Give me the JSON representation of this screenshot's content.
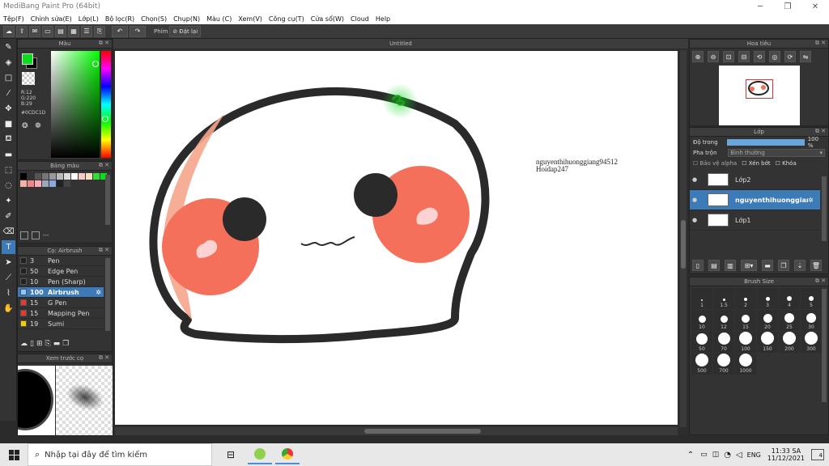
{
  "window": {
    "title": "MediBang Paint Pro (64bit)"
  },
  "menu": [
    "Tệp(F)",
    "Chỉnh sửa(E)",
    "Lớp(L)",
    "Bộ lọc(R)",
    "Chọn(S)",
    "Chụp(N)",
    "Màu (C)",
    "Xem(V)",
    "Công cụ(T)",
    "Cửa sổ(W)",
    "Cloud",
    "Help"
  ],
  "toolbar": {
    "shortcut_label": "Phím",
    "reset_label": "Đặt lại"
  },
  "canvas": {
    "title": "Untitled",
    "watermark_line1": "nguyenthihuonggiang94512",
    "watermark_line2": "Hoidap247"
  },
  "color_panel": {
    "title": "Màu",
    "r": "R:12",
    "g": "G:220",
    "b": "B:29",
    "hex": "#0CDC1D",
    "fg_color": "#0CDC1D",
    "bg_color": "#000000"
  },
  "palette_panel": {
    "title": "Bảng màu",
    "footer": "---"
  },
  "brush_panel": {
    "title": "Cọ: Airbrush",
    "brushes": [
      {
        "size": "3",
        "name": "Pen",
        "color": "#222222"
      },
      {
        "size": "50",
        "name": "Edge Pen",
        "color": "#222222"
      },
      {
        "size": "10",
        "name": "Pen (Sharp)",
        "color": "#222222"
      },
      {
        "size": "100",
        "name": "Airbrush",
        "color": "#8fc8ff"
      },
      {
        "size": "15",
        "name": "G Pen",
        "color": "#e53935"
      },
      {
        "size": "15",
        "name": "Mapping Pen",
        "color": "#e53935"
      },
      {
        "size": "19",
        "name": "Sumi",
        "color": "#f2d000"
      }
    ]
  },
  "preview_panel": {
    "title": "Xem trước cọ"
  },
  "navigator_panel": {
    "title": "Hoa tiêu"
  },
  "layer_panel": {
    "title": "Lớp",
    "opacity_label": "Độ trong",
    "opacity_value": "100 %",
    "blend_label": "Pha trộn",
    "blend_value": "Bình thường",
    "protect_alpha": "Bảo vệ alpha",
    "clipping": "Xén bớt",
    "lock": "Khóa",
    "layers": [
      {
        "name": "Lớp2"
      },
      {
        "name": "nguyenthihuonggian"
      },
      {
        "name": "Lớp1"
      }
    ]
  },
  "brush_size_panel": {
    "title": "Brush Size",
    "sizes": [
      "1",
      "1.5",
      "2",
      "3",
      "4",
      "5",
      "10",
      "12",
      "15",
      "20",
      "25",
      "30",
      "50",
      "70",
      "100",
      "150",
      "200",
      "300",
      "500",
      "700",
      "1000"
    ]
  },
  "taskbar": {
    "search_placeholder": "Nhập tại đây để tìm kiếm",
    "lang": "ENG",
    "time": "11:33 SA",
    "date": "11/12/2021",
    "notif_count": "4"
  }
}
